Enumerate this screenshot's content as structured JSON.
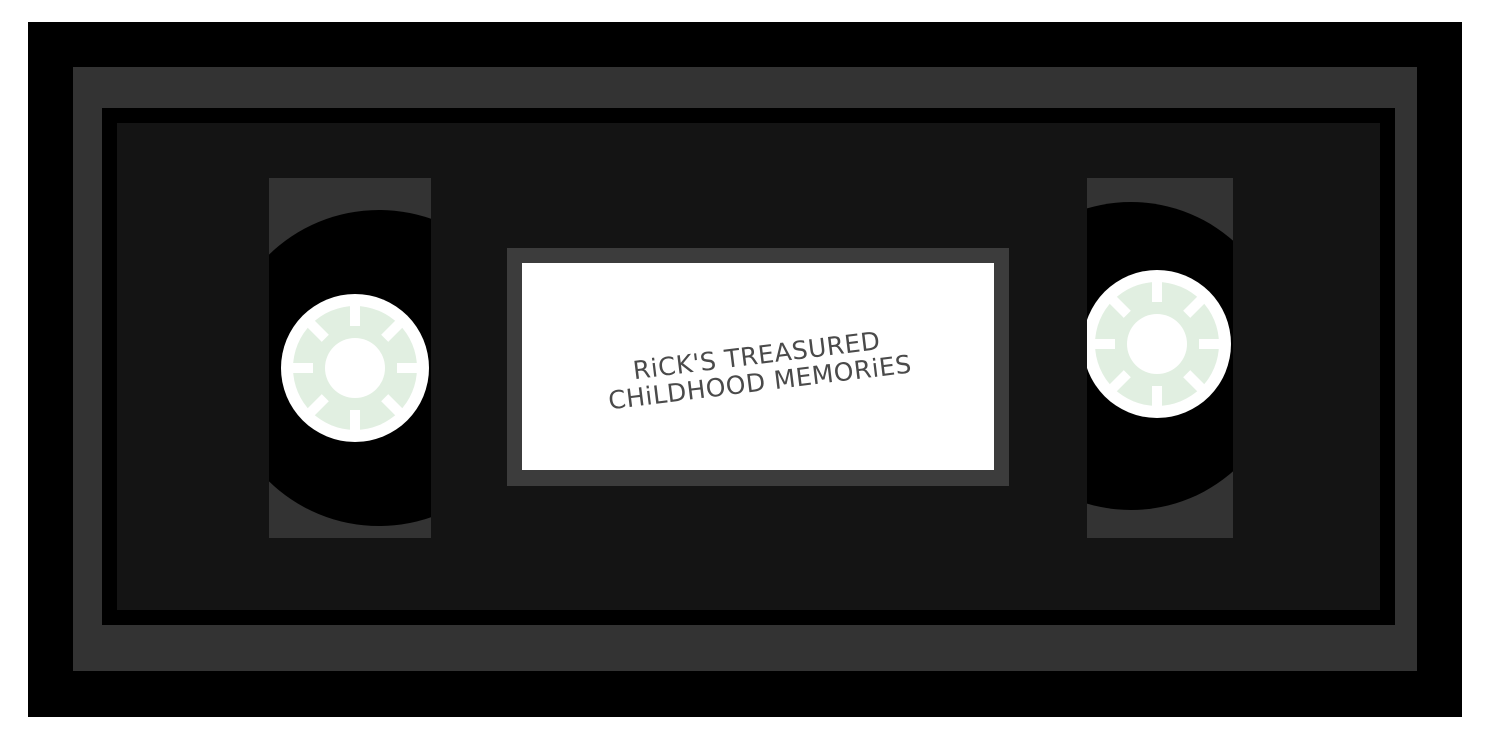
{
  "cassette": {
    "label_lines": [
      "RiCK'S TREASURED",
      "CHiLDHOOD MEMORiES"
    ]
  },
  "colors": {
    "shell": "#000000",
    "frame": "#333333",
    "body": "#141414",
    "label_border": "#3c3c3c",
    "label_bg": "#ffffff",
    "label_text": "#4a4a4a",
    "tape": "#000000",
    "hub": "#ffffff",
    "hub_teeth": "#e1efe1"
  },
  "icons": [
    "left-reel-icon",
    "right-reel-icon"
  ]
}
